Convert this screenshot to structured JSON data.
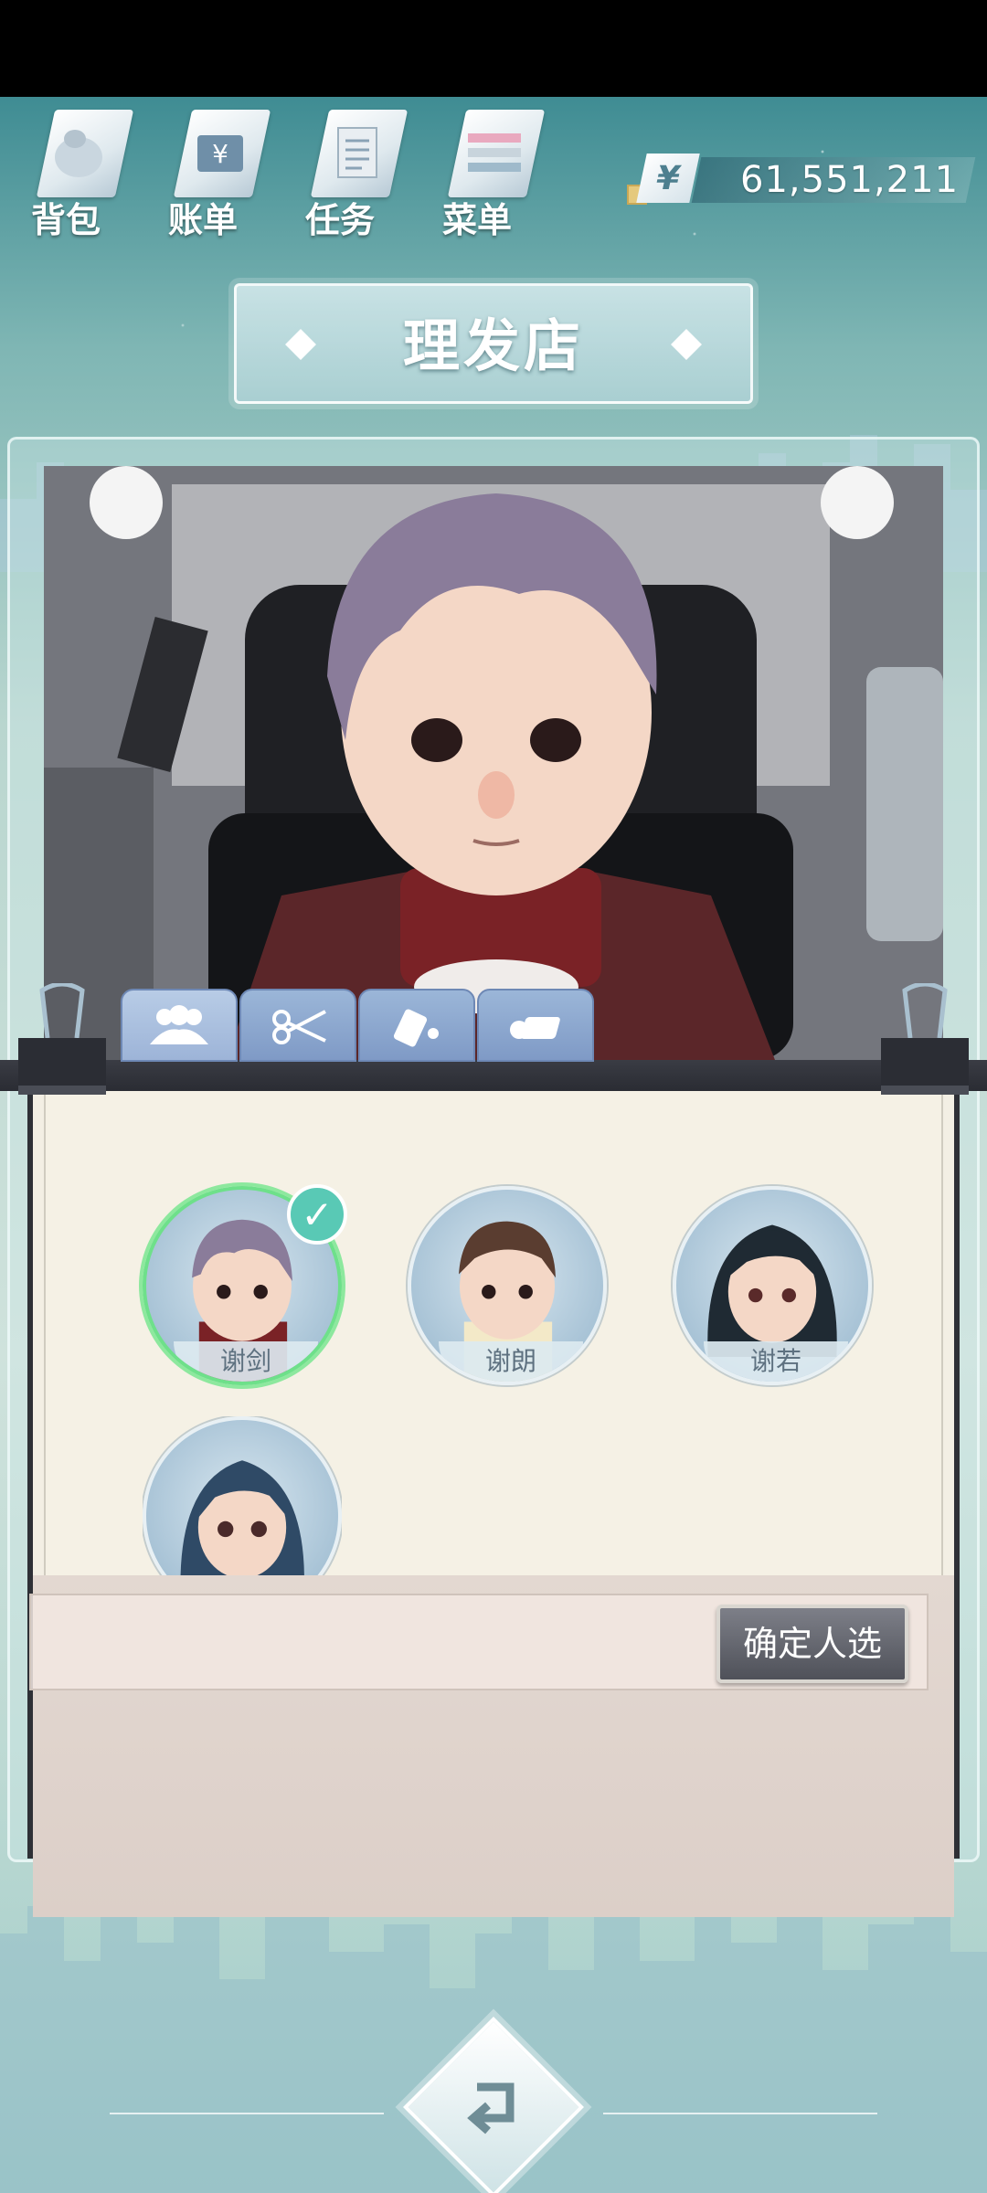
{
  "menu": [
    {
      "label": "背包",
      "icon": "bag-icon"
    },
    {
      "label": "账单",
      "icon": "bill-icon"
    },
    {
      "label": "任务",
      "icon": "task-icon"
    },
    {
      "label": "菜单",
      "icon": "menu-icon"
    }
  ],
  "currency": {
    "symbol": "¥",
    "amount": "61,551,211"
  },
  "title": "理发店",
  "tabs": [
    {
      "name": "people",
      "icon": "people-icon",
      "active": true
    },
    {
      "name": "scissors",
      "icon": "scissors-icon",
      "active": false
    },
    {
      "name": "dye",
      "icon": "dye-icon",
      "active": false
    },
    {
      "name": "eraser",
      "icon": "eraser-icon",
      "active": false
    }
  ],
  "characters": [
    {
      "name": "谢剑",
      "selected": true
    },
    {
      "name": "谢朗",
      "selected": false
    },
    {
      "name": "谢若",
      "selected": false
    },
    {
      "name": "",
      "selected": false
    }
  ],
  "confirm_label": "确定人选",
  "colors": {
    "accent": "#59c9b5",
    "tab": "#8aa6d0",
    "selected_ring": "#6ee08a"
  }
}
